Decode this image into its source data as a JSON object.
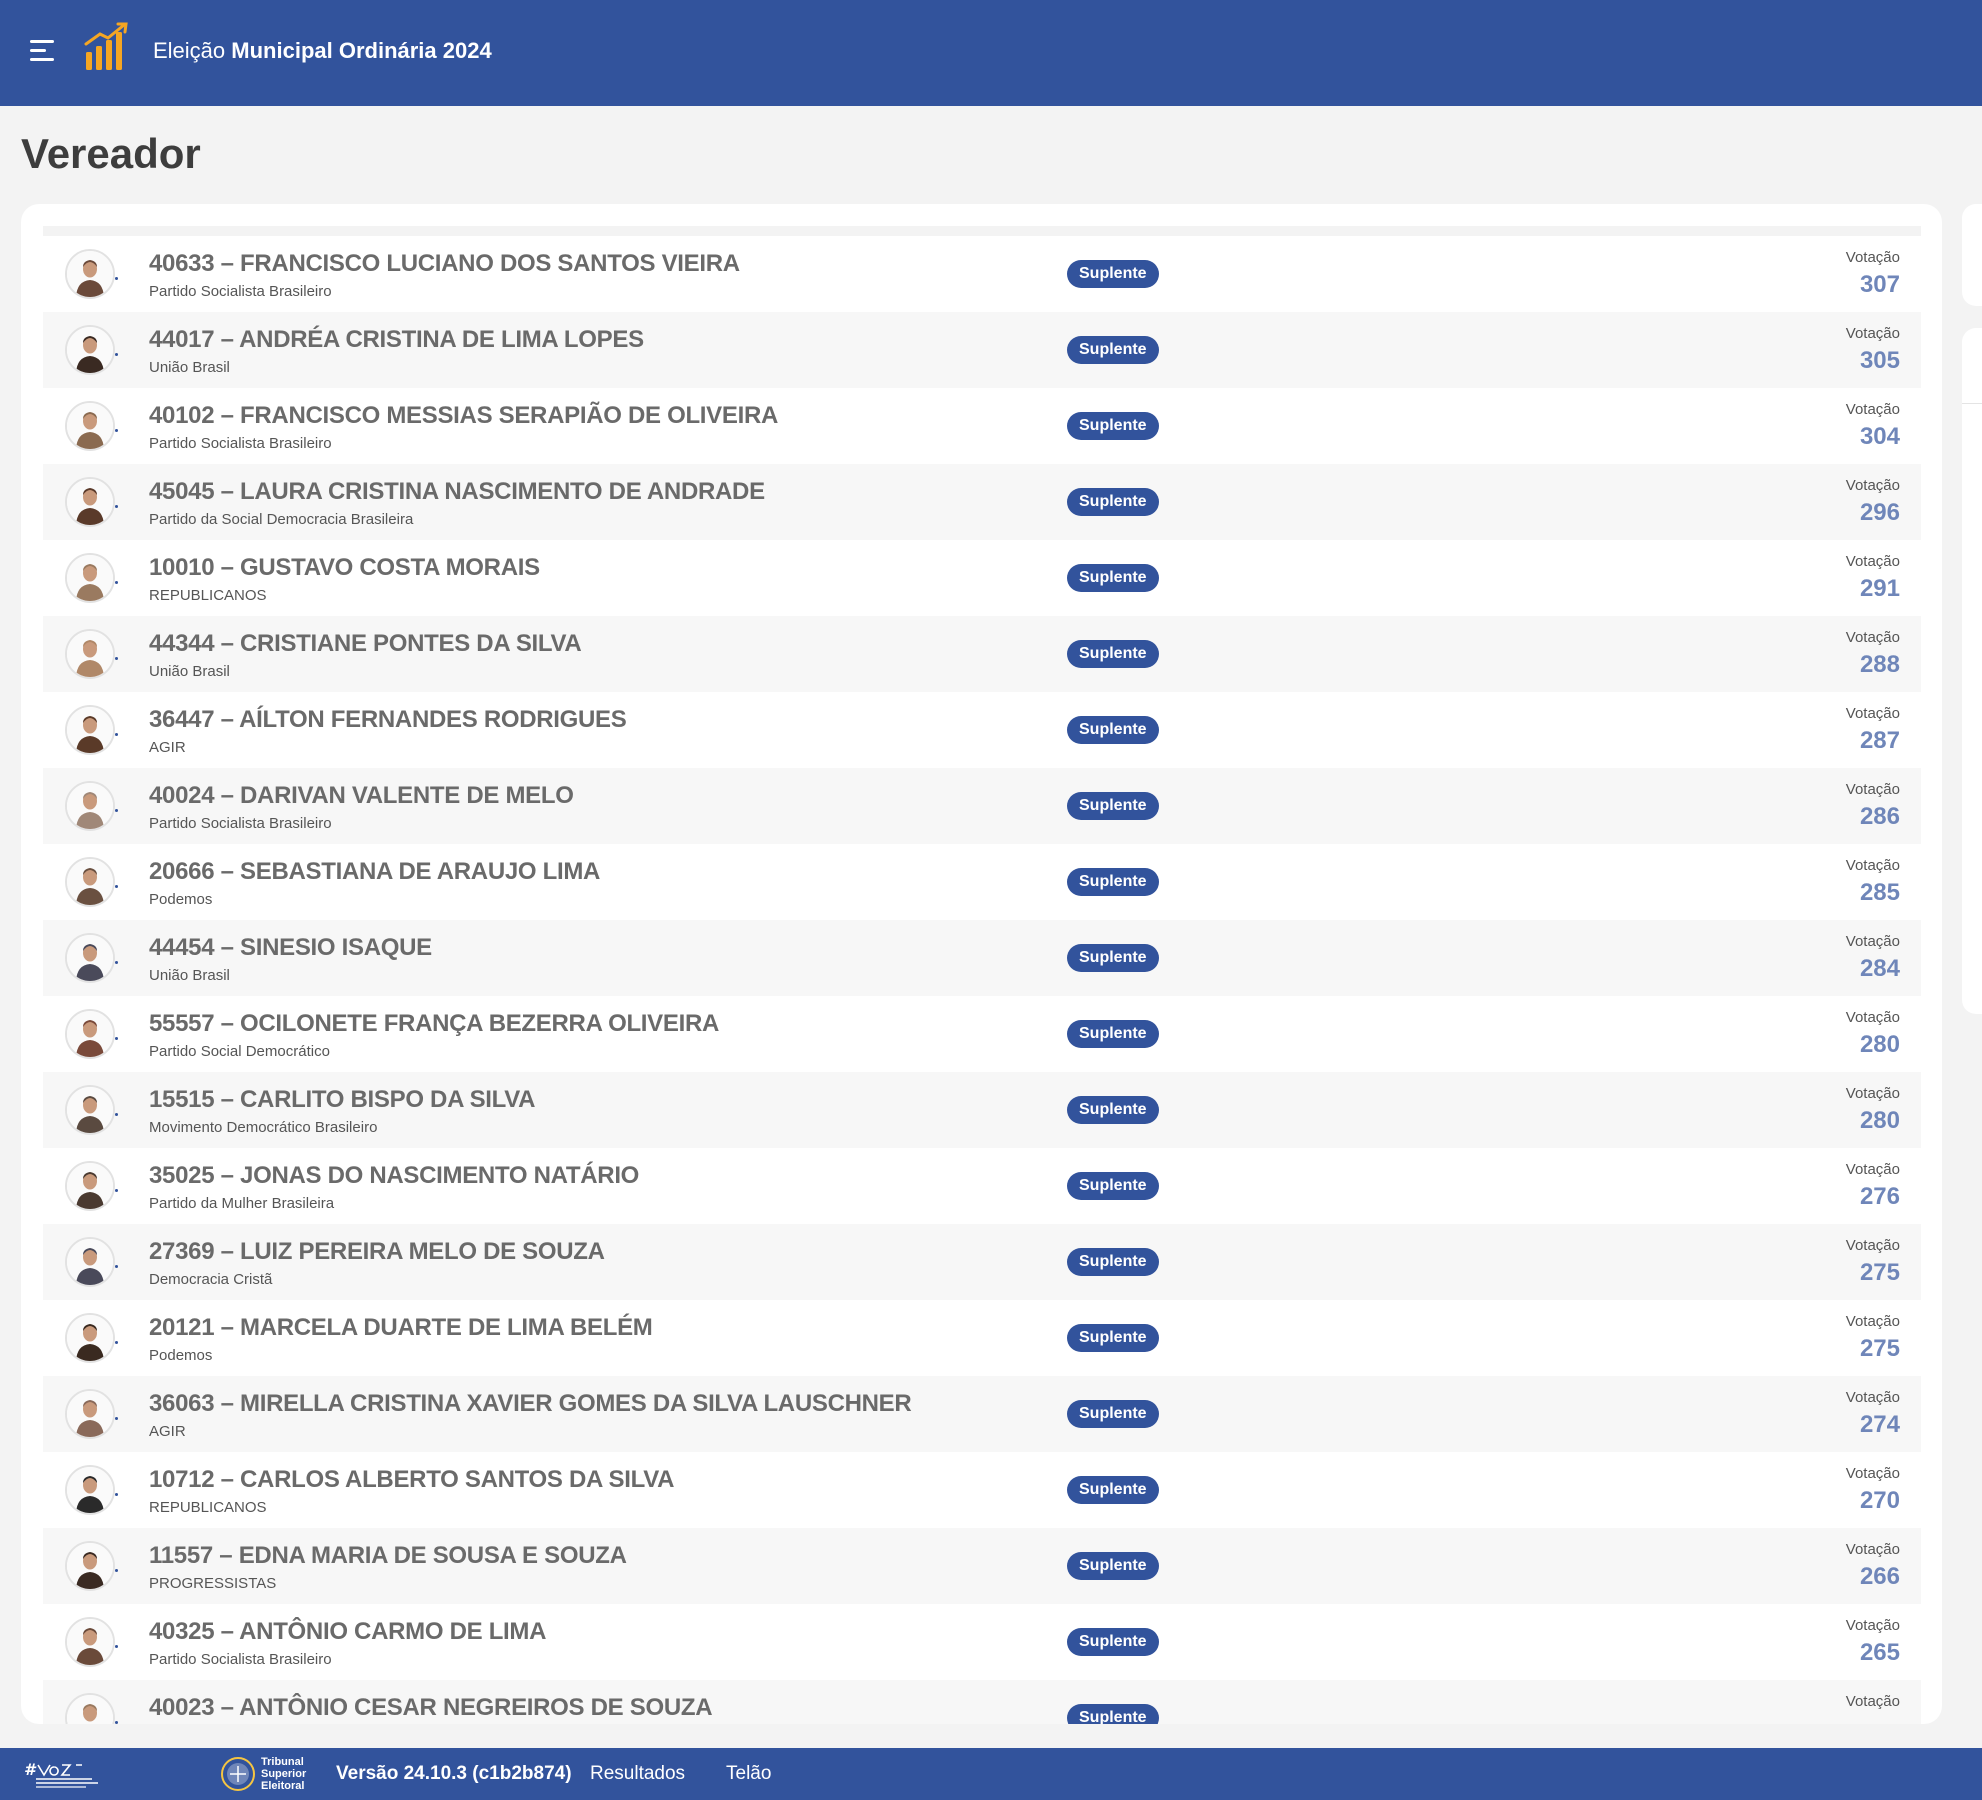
{
  "header": {
    "title_prefix": "Eleição",
    "title_bold": "Municipal Ordinária 2024"
  },
  "page_title": "Vereador",
  "candidates": [
    {
      "name": "40633 – FRANCISCO LUCIANO DOS SANTOS VIEIRA",
      "party": "Partido Socialista Brasileiro",
      "status": "Suplente",
      "vote_label": "Votação",
      "votes": "307"
    },
    {
      "name": "44017 – ANDRÉA CRISTINA DE LIMA LOPES",
      "party": "União Brasil",
      "status": "Suplente",
      "vote_label": "Votação",
      "votes": "305"
    },
    {
      "name": "40102 – FRANCISCO MESSIAS SERAPIÃO DE OLIVEIRA",
      "party": "Partido Socialista Brasileiro",
      "status": "Suplente",
      "vote_label": "Votação",
      "votes": "304"
    },
    {
      "name": "45045 – LAURA CRISTINA NASCIMENTO DE ANDRADE",
      "party": "Partido da Social Democracia Brasileira",
      "status": "Suplente",
      "vote_label": "Votação",
      "votes": "296"
    },
    {
      "name": "10010 – GUSTAVO COSTA MORAIS",
      "party": "REPUBLICANOS",
      "status": "Suplente",
      "vote_label": "Votação",
      "votes": "291"
    },
    {
      "name": "44344 – CRISTIANE PONTES DA SILVA",
      "party": "União Brasil",
      "status": "Suplente",
      "vote_label": "Votação",
      "votes": "288"
    },
    {
      "name": "36447 – AÍLTON FERNANDES RODRIGUES",
      "party": "AGIR",
      "status": "Suplente",
      "vote_label": "Votação",
      "votes": "287"
    },
    {
      "name": "40024 – DARIVAN VALENTE DE MELO",
      "party": "Partido Socialista Brasileiro",
      "status": "Suplente",
      "vote_label": "Votação",
      "votes": "286"
    },
    {
      "name": "20666 – SEBASTIANA DE ARAUJO LIMA",
      "party": "Podemos",
      "status": "Suplente",
      "vote_label": "Votação",
      "votes": "285"
    },
    {
      "name": "44454 – SINESIO ISAQUE",
      "party": "União Brasil",
      "status": "Suplente",
      "vote_label": "Votação",
      "votes": "284"
    },
    {
      "name": "55557 – OCILONETE FRANÇA BEZERRA OLIVEIRA",
      "party": "Partido Social Democrático",
      "status": "Suplente",
      "vote_label": "Votação",
      "votes": "280"
    },
    {
      "name": "15515 – CARLITO BISPO DA SILVA",
      "party": "Movimento Democrático Brasileiro",
      "status": "Suplente",
      "vote_label": "Votação",
      "votes": "280"
    },
    {
      "name": "35025 – JONAS DO NASCIMENTO NATÁRIO",
      "party": "Partido da Mulher Brasileira",
      "status": "Suplente",
      "vote_label": "Votação",
      "votes": "276"
    },
    {
      "name": "27369 – LUIZ PEREIRA MELO DE SOUZA",
      "party": "Democracia Cristã",
      "status": "Suplente",
      "vote_label": "Votação",
      "votes": "275"
    },
    {
      "name": "20121 – MARCELA DUARTE DE LIMA BELÉM",
      "party": "Podemos",
      "status": "Suplente",
      "vote_label": "Votação",
      "votes": "275"
    },
    {
      "name": "36063 – MIRELLA CRISTINA XAVIER GOMES DA SILVA LAUSCHNER",
      "party": "AGIR",
      "status": "Suplente",
      "vote_label": "Votação",
      "votes": "274"
    },
    {
      "name": "10712 – CARLOS ALBERTO SANTOS DA SILVA",
      "party": "REPUBLICANOS",
      "status": "Suplente",
      "vote_label": "Votação",
      "votes": "270"
    },
    {
      "name": "11557 – EDNA MARIA DE SOUSA E SOUZA",
      "party": "PROGRESSISTAS",
      "status": "Suplente",
      "vote_label": "Votação",
      "votes": "266"
    },
    {
      "name": "40325 – ANTÔNIO CARMO DE LIMA",
      "party": "Partido Socialista Brasileiro",
      "status": "Suplente",
      "vote_label": "Votação",
      "votes": "265"
    },
    {
      "name": "40023 – ANTÔNIO CESAR NEGREIROS DE SOUZA",
      "party": "",
      "status": "Suplente",
      "vote_label": "Votação",
      "votes": ""
    }
  ],
  "avatar_colors": [
    "#6b4a3a",
    "#3a2a22",
    "#8a6a50",
    "#5a3a2a",
    "#9a7a60",
    "#b08868",
    "#5a3a28",
    "#a08878",
    "#6a5040",
    "#4a4a5a",
    "#7a4a3a",
    "#5a4a40",
    "#4a3a30",
    "#4a4a5a",
    "#3a2a20",
    "#8a6a5a",
    "#2a2a2a",
    "#3a2a22",
    "#6a4a3a",
    "#9a7a60"
  ],
  "footer": {
    "org_line1": "Tribunal",
    "org_line2": "Superior",
    "org_line3": "Eleitoral",
    "version": "Versão 24.10.3 (c1b2b874)",
    "link_results": "Resultados",
    "link_telao": "Telão"
  },
  "colors": {
    "primary": "#32539c",
    "logo_accent": "#f5a623",
    "vote_value": "#6f86b9"
  }
}
